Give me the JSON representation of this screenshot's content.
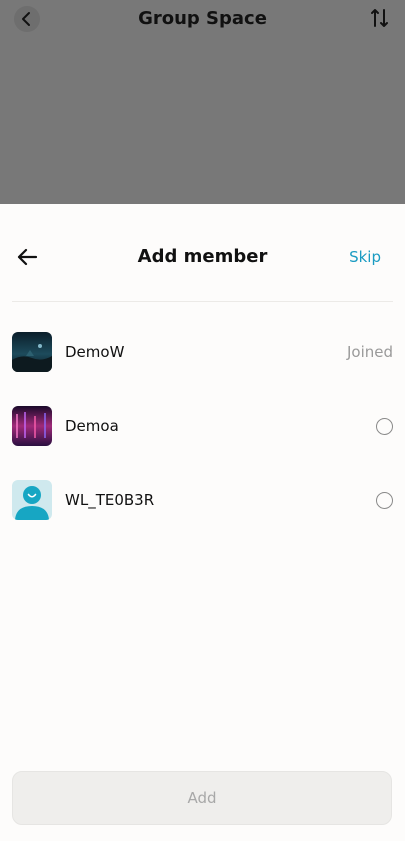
{
  "background": {
    "title": "Group Space",
    "back_icon": "chevron-left-icon",
    "sort_icon": "sort-icon"
  },
  "sheet": {
    "title": "Add member",
    "skip_label": "Skip",
    "back_icon": "arrow-left-icon"
  },
  "members": [
    {
      "name": "DemoW",
      "status": "Joined",
      "avatar": "night-landscape"
    },
    {
      "name": "Demoa",
      "status": "",
      "avatar": "pink-lights"
    },
    {
      "name": "WL_TE0B3R",
      "status": "",
      "avatar": "default-user"
    }
  ],
  "add_button": {
    "label": "Add"
  },
  "colors": {
    "accent": "#1a9bc2",
    "dim": "#787878"
  }
}
